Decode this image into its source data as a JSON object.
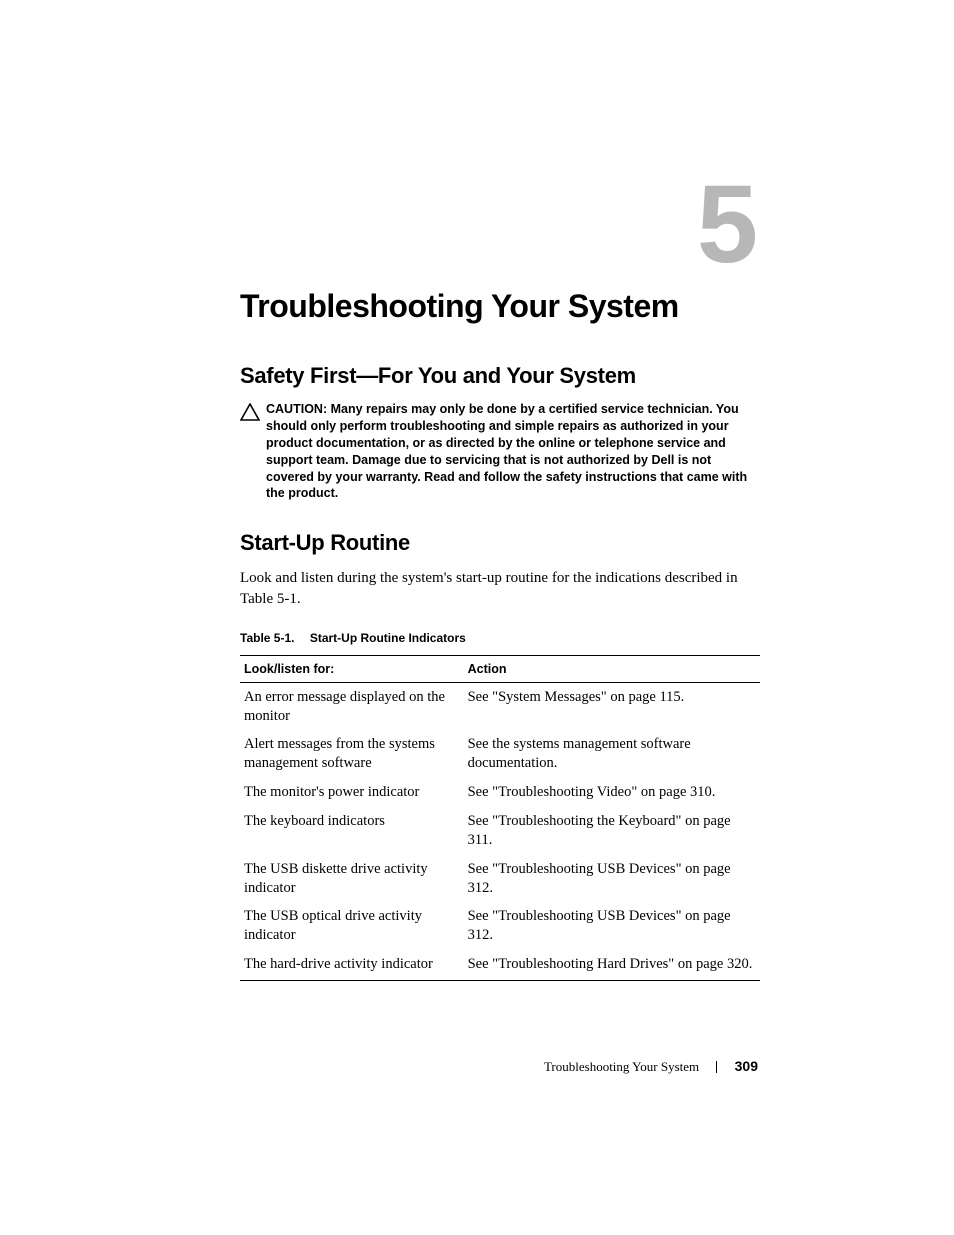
{
  "chapter": {
    "number": "5",
    "title": "Troubleshooting Your System"
  },
  "section1": {
    "heading": "Safety First—For You and Your System",
    "caution_label": "CAUTION:",
    "caution_body": "Many repairs may only be done by a certified service technician. You should only perform troubleshooting and simple repairs as authorized in your product documentation, or as directed by the online or telephone service and support team. Damage due to servicing that is not authorized by Dell is not covered by your warranty. Read and follow the safety instructions that came with the product."
  },
  "section2": {
    "heading": "Start-Up Routine",
    "body": "Look and listen during the system's start-up routine for the indications described in Table 5-1."
  },
  "table": {
    "caption_id": "Table 5-1.",
    "caption_title": "Start-Up Routine Indicators",
    "headers": {
      "look": "Look/listen for:",
      "action": "Action"
    },
    "rows": [
      {
        "look": "An error message displayed on the monitor",
        "action": "See \"System Messages\" on page 115."
      },
      {
        "look": "Alert messages from the systems management software",
        "action": "See the systems management software documentation."
      },
      {
        "look": "The monitor's power indicator",
        "action": "See \"Troubleshooting Video\" on page 310."
      },
      {
        "look": "The keyboard indicators",
        "action": "See \"Troubleshooting the Keyboard\" on page 311."
      },
      {
        "look": "The USB diskette drive activity indicator",
        "action": "See \"Troubleshooting USB Devices\" on page 312."
      },
      {
        "look": "The USB optical drive activity indicator",
        "action": "See \"Troubleshooting USB Devices\" on page 312."
      },
      {
        "look": "The hard-drive activity indicator",
        "action": "See \"Troubleshooting Hard Drives\" on page 320."
      }
    ]
  },
  "footer": {
    "text": "Troubleshooting Your System",
    "page": "309"
  }
}
